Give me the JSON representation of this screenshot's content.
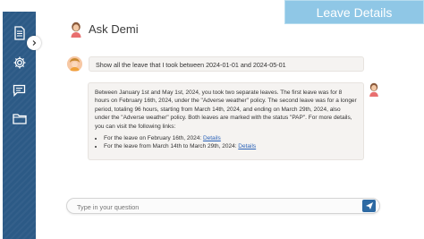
{
  "banner": {
    "title": "Leave Details"
  },
  "header": {
    "title": "Ask Demi"
  },
  "sidebar": {
    "items": [
      {
        "icon": "document-icon"
      },
      {
        "icon": "gear-icon"
      },
      {
        "icon": "chat-icon"
      },
      {
        "icon": "folder-icon"
      }
    ],
    "collapse_icon": "chevron-right-icon"
  },
  "conversation": {
    "user_message": "Show all the leave that I took between 2024-01-01 and 2024-05-01",
    "bot_message": {
      "paragraph": "Between January 1st and May 1st, 2024, you took two separate leaves. The first leave was for 8 hours on February 16th, 2024, under the \"Adverse weather\" policy. The second leave was for a longer period, totaling 96 hours, starting from March 14th, 2024, and ending on March 29th, 2024, also under the \"Adverse weather\" policy. Both leaves are marked with the status \"PAP\". For more details, you can visit the following links:",
      "links": [
        {
          "text": "For the leave on February 16th, 2024: ",
          "link_label": "Details"
        },
        {
          "text": "For the leave from March 14th to March 29th, 2024: ",
          "link_label": "Details"
        }
      ]
    }
  },
  "input": {
    "placeholder": "Type in your question"
  },
  "colors": {
    "sidebar": "#2c5a86",
    "banner": "#8fc7e6",
    "send_button": "#2e6aa3",
    "link": "#2a62b8"
  }
}
